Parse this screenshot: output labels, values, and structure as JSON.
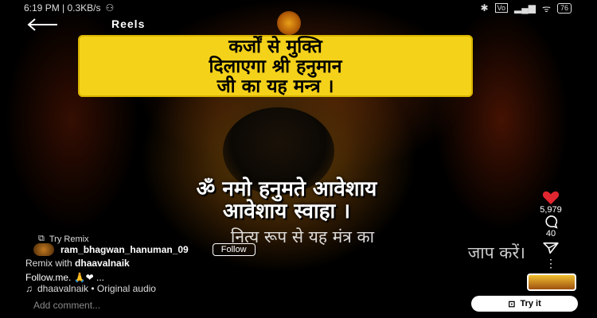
{
  "status_bar": {
    "time_speed": "6:19 PM | 0.3KB/s",
    "battery": "76"
  },
  "topbar": {
    "title": "Reels"
  },
  "banner": {
    "lines": [
      "कर्जों से मुक्ति",
      "दिलाएगा श्री हनुमान",
      "जी का यह मन्त्र ।"
    ]
  },
  "mantra": {
    "lines": [
      "ॐ नमो हनुमते आवेशाय",
      "आवेशाय स्वाहा ।"
    ]
  },
  "overlay_text": {
    "line1": "नित्य रूप से यह मंत्र का",
    "line2": "जाप करें।"
  },
  "reel": {
    "try_remix": "Try Remix",
    "username": "ram_bhagwan_hanuman_09",
    "follow": "Follow",
    "remix_with_prefix": "Remix with",
    "remix_with_user": "dhaavalnaik",
    "caption": "Follow.me. 🙏❤ ...",
    "audio": "dhaavalnaik • Original audio"
  },
  "comment": {
    "placeholder": "Add comment..."
  },
  "try_it": {
    "label": "Try it"
  },
  "actions": {
    "likes": "5,979",
    "comments": "40"
  },
  "colors": {
    "banner": "#f5d21a",
    "heart": "#e0262f"
  }
}
